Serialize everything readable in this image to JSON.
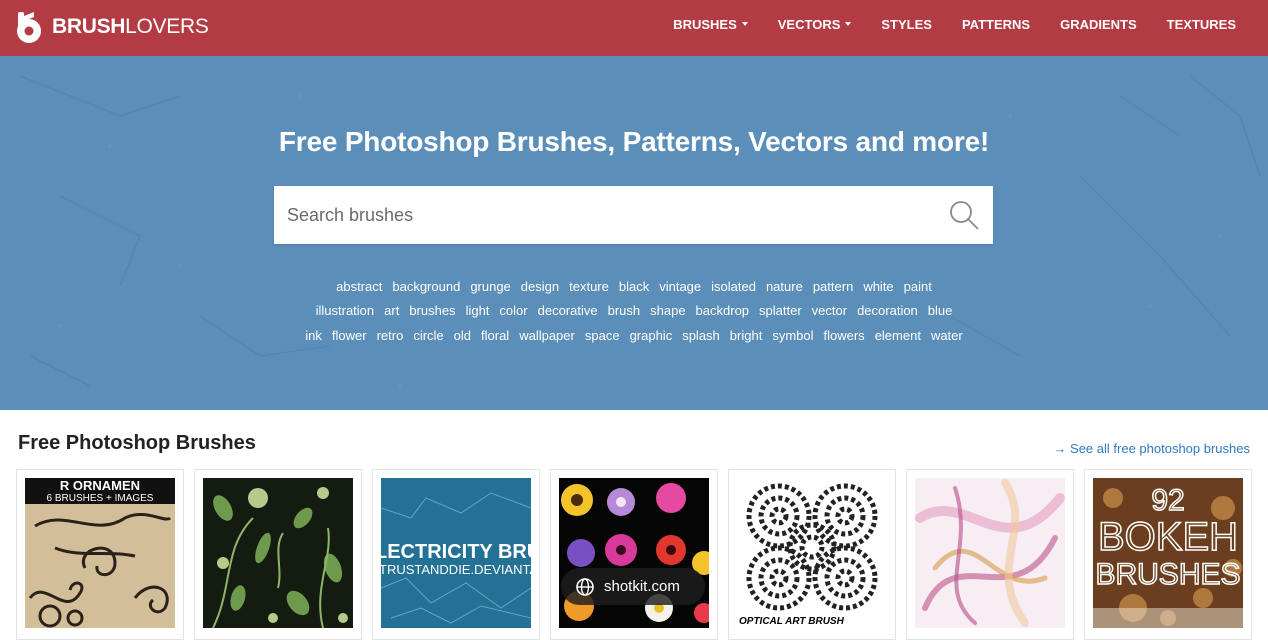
{
  "header": {
    "brand_bold": "BRUSH",
    "brand_light": "LOVERS",
    "nav": [
      {
        "label": "BRUSHES",
        "dropdown": true
      },
      {
        "label": "VECTORS",
        "dropdown": true
      },
      {
        "label": "STYLES",
        "dropdown": false
      },
      {
        "label": "PATTERNS",
        "dropdown": false
      },
      {
        "label": "GRADIENTS",
        "dropdown": false
      },
      {
        "label": "TEXTURES",
        "dropdown": false
      }
    ],
    "color": "#b33b43"
  },
  "hero": {
    "title": "Free Photoshop Brushes, Patterns, Vectors and more!",
    "search_placeholder": "Search brushes",
    "color": "#5b8fb9",
    "tag_rows": [
      [
        "abstract",
        "background",
        "grunge",
        "design",
        "texture",
        "black",
        "vintage",
        "isolated",
        "nature",
        "pattern",
        "white",
        "paint"
      ],
      [
        "illustration",
        "art",
        "brushes",
        "light",
        "color",
        "decorative",
        "brush",
        "shape",
        "backdrop",
        "splatter",
        "vector",
        "decoration",
        "blue"
      ],
      [
        "ink",
        "flower",
        "retro",
        "circle",
        "old",
        "floral",
        "wallpaper",
        "space",
        "graphic",
        "splash",
        "bright",
        "symbol",
        "flowers",
        "element",
        "water"
      ]
    ]
  },
  "section": {
    "title": "Free Photoshop Brushes",
    "see_all": "→ See all free photoshop brushes"
  },
  "thumbnails": [
    {
      "name": "ornament-brushes",
      "text_top": "R ORNAMEN",
      "text_sub": "6 BRUSHES + IMAGES"
    },
    {
      "name": "plant-brushes"
    },
    {
      "name": "electricity-brushes",
      "text_top": "LECTRICITY BRUSH",
      "text_sub": "TRUSTANDDIE.DEVIANTAR"
    },
    {
      "name": "flower-brushes"
    },
    {
      "name": "optical-art-brush",
      "text_top": "OPTICAL ART BRUSH"
    },
    {
      "name": "light-trail-brushes"
    },
    {
      "name": "bokeh-brushes",
      "text_top": "92",
      "text_mid": "BOKEH",
      "text_sub": "BRUSHES"
    }
  ],
  "watermark": {
    "text": "shotkit.com"
  }
}
